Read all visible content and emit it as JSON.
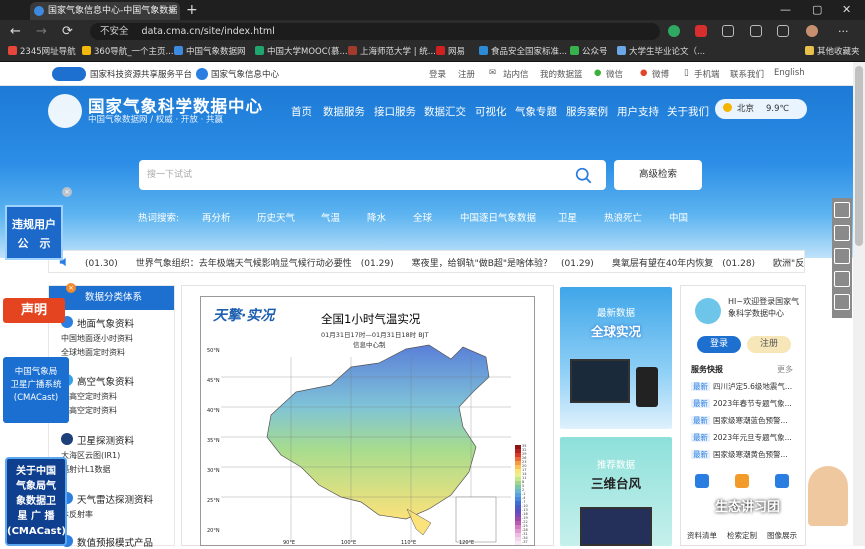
{
  "browser": {
    "tab_title": "国家气象信息中心-中国气象数据",
    "tab_close": "×",
    "new_tab": "+",
    "window_controls": [
      "—",
      "▢",
      "✕"
    ],
    "nav": {
      "back": "←",
      "forward": "→",
      "reload": "⟳"
    },
    "security_label": "不安全",
    "url": "data.cma.cn/site/index.html",
    "bookmarks": [
      "2345网址导航",
      "360导航_一个主页...",
      "中国气象数据网",
      "中国大学MOOC(慕...",
      "上海师范大学 | 统...",
      "网易",
      "食品安全国家标准...",
      "公众号",
      "大学生毕业论文（..."
    ],
    "other_bookmarks": "其他收藏夹",
    "bookmark_colors": [
      "#e8463b",
      "#f2b90c",
      "#3c8be0",
      "#1fa56e",
      "#a33b2c",
      "#d02020",
      "#2b8bd6",
      "#37b24d",
      "#6aa8e8"
    ]
  },
  "site": {
    "util_bar": {
      "org1": "国家科技资源共享服务平台",
      "org2": "国家气象信息中心",
      "links": [
        "登录",
        "注册",
        "站内信",
        "我的数据篮",
        "微信",
        "微博",
        "手机端",
        "联系我们",
        "English"
      ]
    },
    "header": {
      "title": "国家气象科学数据中心",
      "subtitle": "中国气象数据网 / 权威 · 开放 · 共赢",
      "nav": [
        "首页",
        "数据服务",
        "接口服务",
        "数据汇交",
        "可视化",
        "气象专题",
        "服务案例",
        "用户支持",
        "关于我们"
      ],
      "weather_city": "北京",
      "weather_temp": "9.9℃"
    },
    "search": {
      "placeholder": "搜一下试试",
      "advanced": "高级检索",
      "hot_label": "热词搜索:",
      "hot_words": [
        "再分析",
        "历史天气",
        "气温",
        "降水",
        "全球",
        "中国逐日气象数据",
        "卫星",
        "热浪死亡",
        "中国"
      ]
    },
    "ticker": "(01.30)　　世界气象组织：去年极端天气候影响显气候行动必要性　(01.29)　　寒夜里，给钢轨\"做B超\"是啥体验？　(01.29)　　臭氧层有望在40年内恢复　(01.28)　　欧洲\"反常",
    "categories": {
      "title": "数据分类体系",
      "groups": [
        {
          "name": "地面气象资料",
          "items": [
            "中国地面逐小时资料",
            "全球地面定时资料"
          ]
        },
        {
          "name": "高空气象资料",
          "items": [
            "国高空定时资料",
            "国高空定时资料"
          ]
        },
        {
          "name": "卫星探测资料",
          "items": [
            "大海区云图(IR1)",
            "辐射计L1数据"
          ]
        },
        {
          "name": "天气雷达探测资料",
          "items": [
            "本反射率"
          ]
        },
        {
          "name": "数值预报模式产品",
          "items": []
        }
      ]
    },
    "map": {
      "logo": "天擎·实况",
      "title": "全国1小时气温实况",
      "time": "01月31日17时—01月31日18时 BJT",
      "source": "信息中心制",
      "legend_values": [
        "35",
        "32",
        "29",
        "26",
        "23",
        "20",
        "17",
        "14",
        "11",
        "8",
        "5",
        "2",
        "-1",
        "-4",
        "-7",
        "-10",
        "-13",
        "-16",
        "-19",
        "-22",
        "-25",
        "-28",
        "-31",
        "-34",
        "-37"
      ],
      "legend_colors": [
        "#8b1414",
        "#b52020",
        "#d83a2a",
        "#ec6a3a",
        "#f59a45",
        "#f9c35a",
        "#fbe27a",
        "#e8f08a",
        "#c6e78e",
        "#9fd68c",
        "#7cc7a6",
        "#6ab7cf",
        "#5aa1e0",
        "#4a87dd",
        "#3f6dd6",
        "#4a5bc8",
        "#5b4fc0",
        "#7a4ab8",
        "#9a4aa8",
        "#b85ab0",
        "#d37ac0",
        "#e29ad0",
        "#efbbe0",
        "#f5d5ec",
        "#faeaf5"
      ],
      "lat_labels": [
        "50°N",
        "45°N",
        "40°N",
        "35°N",
        "30°N",
        "25°N",
        "20°N"
      ],
      "lon_labels": [
        "90°E",
        "100°E",
        "110°E",
        "120°E"
      ]
    },
    "global_card": {
      "small": "最新数据",
      "big": "全球实况"
    },
    "recommend_card": {
      "small": "推荐数据",
      "big": "三维台风"
    },
    "login": {
      "welcome": "HI~欢迎登录国家气象科学数据中心",
      "login_btn": "登录",
      "register_btn": "注册",
      "service_title": "服务快报",
      "more": "更多",
      "new_tag": "最新",
      "news": [
        "四川泸定5.6级地震气...",
        "2023年春节专题气象...",
        "国家级寒潮蓝色预警...",
        "2023年元旦专题气象...",
        "国家级寒潮黄色预警..."
      ],
      "quick_links": [
        "资料清单",
        "检索定制",
        "图像展示"
      ]
    },
    "badges": {
      "report": "违规用户\n公　示",
      "statement": "声明",
      "cast": "中国气象局\n卫星广播系统\n(CMACast)",
      "broadcast": "关于中国\n气象局气\n象数据卫\n星 广 播\n(CMACast)",
      "close": "×"
    },
    "watermark": "生态讲习团"
  }
}
